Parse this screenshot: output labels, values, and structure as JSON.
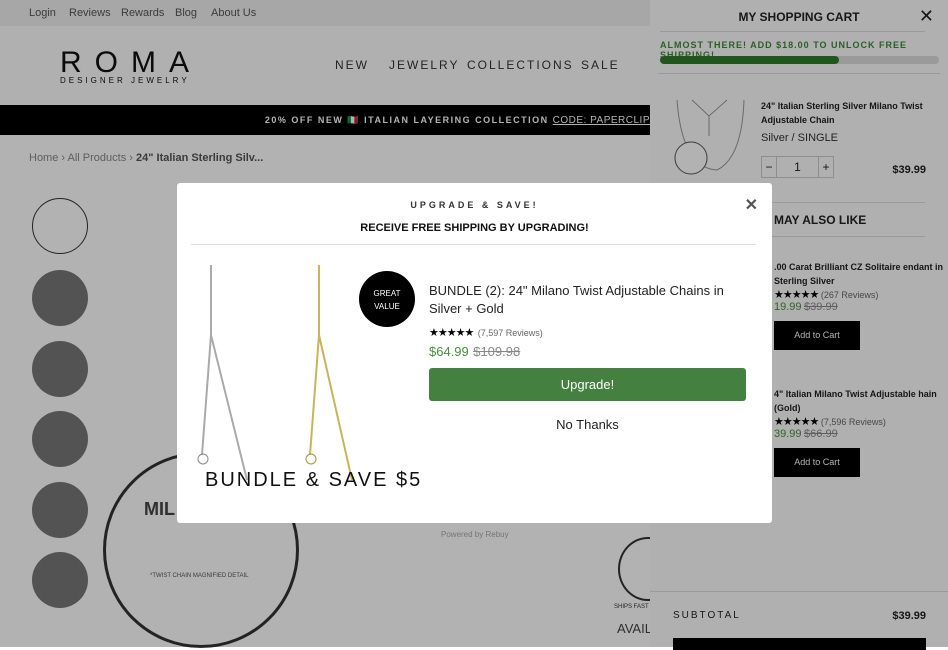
{
  "topbar": {
    "links": [
      "Login",
      "Reviews",
      "Rewards",
      "Blog",
      "About Us"
    ]
  },
  "header": {
    "logo": "ROMA",
    "logo_sub": "DESIGNER JEWELRY",
    "nav": [
      "NEW",
      "JEWELRY",
      "COLLECTIONS",
      "SALE"
    ]
  },
  "promo": {
    "text": "20% OFF NEW 🇮🇹 ITALIAN LAYERING COLLECTION",
    "code": "CODE: PAPERCLIP"
  },
  "breadcrumb": {
    "home": "Home",
    "all": "All Products",
    "current": "24\" Italian Sterling Silv..."
  },
  "product": {
    "magnified_title": "MIL",
    "magnified_caption": "*TWIST CHAIN MAGNIFIED DETAIL",
    "powered": "Powered by Rebuy",
    "ships": "SHIPS FAST",
    "avail": "AVAIL"
  },
  "cart": {
    "title": "MY SHOPPING CART",
    "shipping_msg": "ALMOST THERE! ADD $18.00 TO UNLOCK FREE SHIPPING!",
    "shipping_progress": 0.64,
    "item": {
      "name": "24\" Italian Sterling Silver Milano Twist Adjustable Chain",
      "variant": "Silver / SINGLE",
      "qty": "1",
      "minus": "−",
      "plus": "+",
      "price": "$39.99"
    },
    "also_like": "MAY ALSO LIKE",
    "recs": [
      {
        "name": ".00 Carat Brilliant CZ Solitaire endant in Sterling Silver",
        "stars": "★★★★★",
        "reviews": "(267 Reviews)",
        "sale": "19.99",
        "orig": "$39.99",
        "button": "Add to Cart"
      },
      {
        "name": "4\" Italian Milano Twist Adjustable hain (Gold)",
        "stars": "★★★★★",
        "reviews": "(7,596 Reviews)",
        "sale": "39.99",
        "orig": "$66.99",
        "button": "Add to Cart"
      }
    ],
    "subtotal_label": "SUBTOTAL",
    "subtotal": "$39.99"
  },
  "modal": {
    "kicker": "UPGRADE & SAVE!",
    "title": "RECEIVE FREE SHIPPING BY UPGRADING!",
    "badge_line1": "GREAT",
    "badge_line2": "VALUE",
    "image_text": "BUNDLE & SAVE $5",
    "name": "BUNDLE (2): 24\" Milano Twist Adjustable Chains in Silver + Gold",
    "stars": "★★★★★",
    "reviews": "(7,597 Reviews)",
    "price": "$64.99",
    "orig": "$109.98",
    "upgrade": "Upgrade!",
    "no_thanks": "No Thanks",
    "accent": "#448040"
  }
}
